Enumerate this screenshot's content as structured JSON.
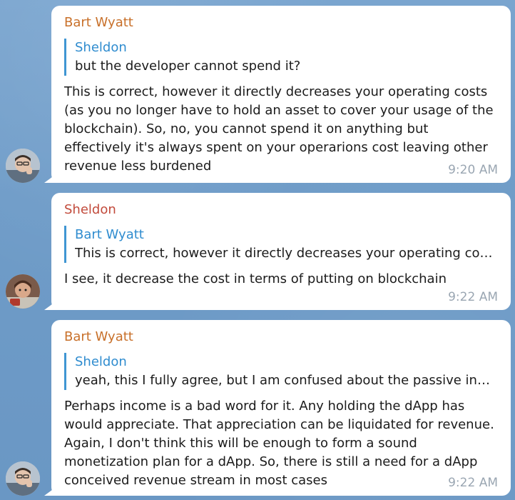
{
  "messages": [
    {
      "sender": "Bart Wyatt",
      "avatar_icon": "avatar-bart-wyatt",
      "reply_to": {
        "name": "Sheldon",
        "text": "but the developer cannot spend it?"
      },
      "text": "This is correct, however it directly decreases your operating costs (as you no longer have to hold an asset to cover your usage of the blockchain).  So, no, you cannot spend it on anything but effectively it's always spent on your operarions cost leaving other revenue less burdened",
      "time": "9:20 AM"
    },
    {
      "sender": "Sheldon",
      "avatar_icon": "avatar-sheldon",
      "reply_to": {
        "name": "Bart Wyatt",
        "text": "This is correct, however it directly decreases your operating cost…"
      },
      "text": "I see, it decrease the cost in terms of putting on blockchain",
      "time": "9:22 AM"
    },
    {
      "sender": "Bart Wyatt",
      "avatar_icon": "avatar-bart-wyatt",
      "reply_to": {
        "name": "Sheldon",
        "text": "yeah, this I fully agree, but I am confused about the passive inco…"
      },
      "text": "Perhaps income is a bad word for it.  Any holding the dApp has would appreciate. That appreciation can be liquidated for revenue.  Again, I don't think this will be enough to form a sound monetization plan for a dApp.  So, there is still a need for a dApp conceived revenue stream in most cases",
      "time": "9:22 AM"
    }
  ]
}
